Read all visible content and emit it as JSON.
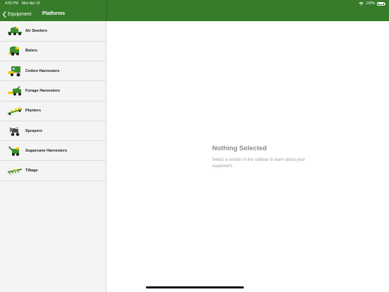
{
  "status": {
    "time": "4:55 PM",
    "date": "Mon Apr 19",
    "battery": "100%"
  },
  "nav": {
    "back_label": "Equipment",
    "title": "Platforms"
  },
  "sidebar": {
    "items": [
      {
        "label": "Air Seeders",
        "icon": "air-seeder-icon"
      },
      {
        "label": "Balers",
        "icon": "baler-icon"
      },
      {
        "label": "Cotton Harvesters",
        "icon": "cotton-harvester-icon"
      },
      {
        "label": "Forage Harvesters",
        "icon": "forage-harvester-icon"
      },
      {
        "label": "Planters",
        "icon": "planter-icon"
      },
      {
        "label": "Sprayers",
        "icon": "sprayer-icon"
      },
      {
        "label": "Sugarcane Harvesters",
        "icon": "sugarcane-harvester-icon"
      },
      {
        "label": "Tillage",
        "icon": "tillage-icon"
      }
    ]
  },
  "detail": {
    "empty_title": "Nothing Selected",
    "empty_text": "Select a section in the sidebar to learn about your equipment."
  },
  "colors": {
    "brand_green": "#367C2B",
    "machine_green": "#3F8E2F",
    "machine_yellow": "#F2C500"
  }
}
